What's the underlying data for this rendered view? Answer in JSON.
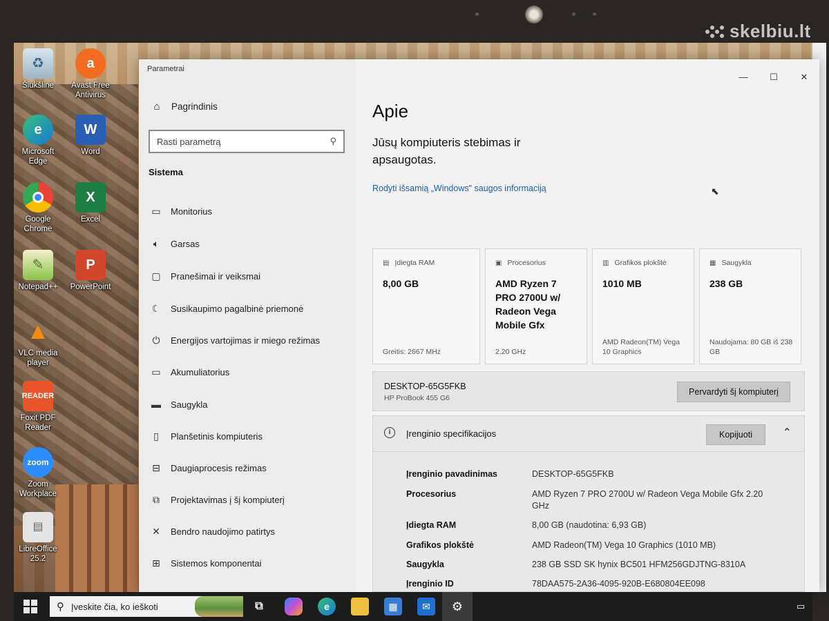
{
  "watermark": "skelbiu.lt",
  "desktop_icons": [
    {
      "label": "Šiukšlinė",
      "icon": "recycle-bin-icon"
    },
    {
      "label": "Avast Free Antivirus",
      "icon": "avast-icon"
    },
    {
      "label": "Microsoft Edge",
      "icon": "edge-icon"
    },
    {
      "label": "Word",
      "icon": "word-icon"
    },
    {
      "label": "Google Chrome",
      "icon": "chrome-icon"
    },
    {
      "label": "Excel",
      "icon": "excel-icon"
    },
    {
      "label": "Notepad++",
      "icon": "notepad-plus-icon"
    },
    {
      "label": "PowerPoint",
      "icon": "powerpoint-icon"
    },
    {
      "label": "VLC media player",
      "icon": "vlc-icon"
    },
    {
      "label": "Foxit PDF Reader",
      "icon": "foxit-icon"
    },
    {
      "label": "Zoom Workplace",
      "icon": "zoom-icon"
    },
    {
      "label": "LibreOffice 25.2",
      "icon": "libreoffice-icon"
    }
  ],
  "window": {
    "title": "Parametrai",
    "controls": {
      "minimize": "—",
      "maximize": "☐",
      "close": "✕"
    }
  },
  "sidebar": {
    "home": "Pagrindinis",
    "search_placeholder": "Rasti parametrą",
    "section": "Sistema",
    "items": [
      {
        "label": "Monitorius",
        "icon": "monitor-icon"
      },
      {
        "label": "Garsas",
        "icon": "speaker-icon"
      },
      {
        "label": "Pranešimai ir veiksmai",
        "icon": "notification-icon"
      },
      {
        "label": "Susikaupimo pagalbinė priemonė",
        "icon": "moon-icon"
      },
      {
        "label": "Energijos vartojimas ir miego režimas",
        "icon": "power-icon"
      },
      {
        "label": "Akumuliatorius",
        "icon": "battery-icon"
      },
      {
        "label": "Saugykla",
        "icon": "storage-icon"
      },
      {
        "label": "Planšetinis kompiuteris",
        "icon": "tablet-icon"
      },
      {
        "label": "Daugiaprocesis režimas",
        "icon": "multitasking-icon"
      },
      {
        "label": "Projektavimas į šį kompiuterį",
        "icon": "projecting-icon"
      },
      {
        "label": "Bendro naudojimo patirtys",
        "icon": "shared-experiences-icon"
      },
      {
        "label": "Sistemos komponentai",
        "icon": "components-icon"
      }
    ]
  },
  "main": {
    "title": "Apie",
    "security_status": "Jūsų kompiuteris stebimas ir apsaugotas.",
    "security_link": "Rodyti išsamią „Windows\" saugos informaciją",
    "cards": [
      {
        "label": "Įdiegta RAM",
        "value": "8,00 GB",
        "sub": "Greitis: 2667 MHz",
        "icon": "ram-icon"
      },
      {
        "label": "Procesorius",
        "value": "AMD Ryzen 7 PRO 2700U w/ Radeon Vega Mobile Gfx",
        "sub": "2.20 GHz",
        "icon": "cpu-icon"
      },
      {
        "label": "Grafikos plokštė",
        "value": "1010 MB",
        "sub": "AMD Radeon(TM) Vega 10 Graphics",
        "icon": "gpu-icon"
      },
      {
        "label": "Saugykla",
        "value": "238 GB",
        "sub": "Naudojama: 80 GB iš 238 GB",
        "icon": "disk-icon"
      }
    ],
    "device_name": "DESKTOP-65G5FKB",
    "device_model": "HP ProBook 455 G6",
    "rename_button": "Pervardyti šį kompiuterį",
    "specs_title": "Įrenginio specifikacijos",
    "copy_button": "Kopijuoti",
    "specs": [
      {
        "key": "Įrenginio pavadinimas",
        "value": "DESKTOP-65G5FKB"
      },
      {
        "key": "Procesorius",
        "value": "AMD Ryzen 7 PRO 2700U w/ Radeon Vega Mobile Gfx 2.20 GHz"
      },
      {
        "key": "Įdiegta RAM",
        "value": "8,00 GB (naudotina: 6,93 GB)"
      },
      {
        "key": "Grafikos plokštė",
        "value": "AMD Radeon(TM) Vega 10 Graphics (1010 MB)"
      },
      {
        "key": "Saugykla",
        "value": "238 GB SSD SK hynix BC501 HFM256GDJTNG-8310A"
      },
      {
        "key": "Įrenginio ID",
        "value": "78DAA575-2A36-4095-920B-E680804EE098"
      }
    ]
  },
  "taskbar": {
    "search_placeholder": "Įveskite čia, ko ieškoti",
    "apps": [
      "task-view-icon",
      "copilot-icon",
      "edge-icon",
      "file-explorer-icon",
      "store-icon",
      "outlook-icon",
      "settings-icon"
    ]
  },
  "colors": {
    "link": "#1a5fb4",
    "taskbar": "#1c1c1c",
    "window_bg": "#f3f3f4"
  }
}
